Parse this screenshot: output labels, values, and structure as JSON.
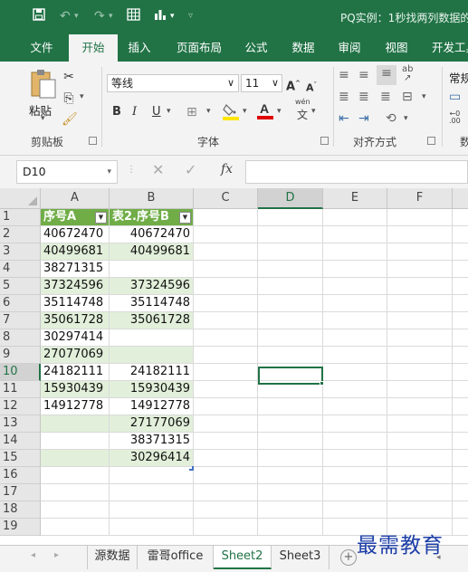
{
  "title_bar": {
    "title": "PQ实例：1秒找两列数据的",
    "icons": [
      "save-icon",
      "undo-icon",
      "redo-icon",
      "table-icon",
      "chart-icon",
      "customize-icon"
    ]
  },
  "ribbon_tabs": [
    "文件",
    "开始",
    "插入",
    "页面布局",
    "公式",
    "数据",
    "审阅",
    "视图",
    "开发工具"
  ],
  "active_tab": "开始",
  "ribbon": {
    "clipboard": {
      "paste_label": "粘贴",
      "group_label": "剪贴板"
    },
    "font": {
      "font_name": "等线",
      "font_size": "11",
      "group_label": "字体",
      "bold": "B",
      "italic": "I",
      "underline": "U",
      "grow": "A",
      "shrink": "A",
      "phonetic": "wén",
      "phonetic_char": "文"
    },
    "alignment": {
      "group_label": "对齐方式"
    },
    "number": {
      "format_partial": "常规",
      "group_partial": "数"
    }
  },
  "formula_bar": {
    "name_box": "D10",
    "fx_label": "fx",
    "formula": ""
  },
  "grid": {
    "columns": [
      "A",
      "B",
      "C",
      "D",
      "E",
      "F"
    ],
    "selected_column": "D",
    "selected_row": "10",
    "active_cell": "D10",
    "row_numbers": [
      "1",
      "2",
      "3",
      "4",
      "5",
      "6",
      "7",
      "8",
      "9",
      "10",
      "11",
      "12",
      "13",
      "14",
      "15",
      "16",
      "17",
      "18",
      "19"
    ],
    "headers": [
      "序号A",
      "表2.序号B"
    ],
    "rows": [
      [
        "40672470",
        "40672470"
      ],
      [
        "40499681",
        "40499681"
      ],
      [
        "38271315",
        ""
      ],
      [
        "37324596",
        "37324596"
      ],
      [
        "35114748",
        "35114748"
      ],
      [
        "35061728",
        "35061728"
      ],
      [
        "30297414",
        ""
      ],
      [
        "27077069",
        ""
      ],
      [
        "24182111",
        "24182111"
      ],
      [
        "15930439",
        "15930439"
      ],
      [
        "14912778",
        "14912778"
      ],
      [
        "",
        "27177069"
      ],
      [
        "",
        "38371315"
      ],
      [
        "",
        "30296414"
      ]
    ]
  },
  "sheet_tabs": [
    "源数据",
    "雷哥office",
    "Sheet2",
    "Sheet3"
  ],
  "active_sheet": "Sheet2",
  "add_sheet": "+",
  "watermark": "最需教育",
  "colors": {
    "excel_green": "#217346",
    "table_header": "#70ad47",
    "band": "#e2efda"
  }
}
